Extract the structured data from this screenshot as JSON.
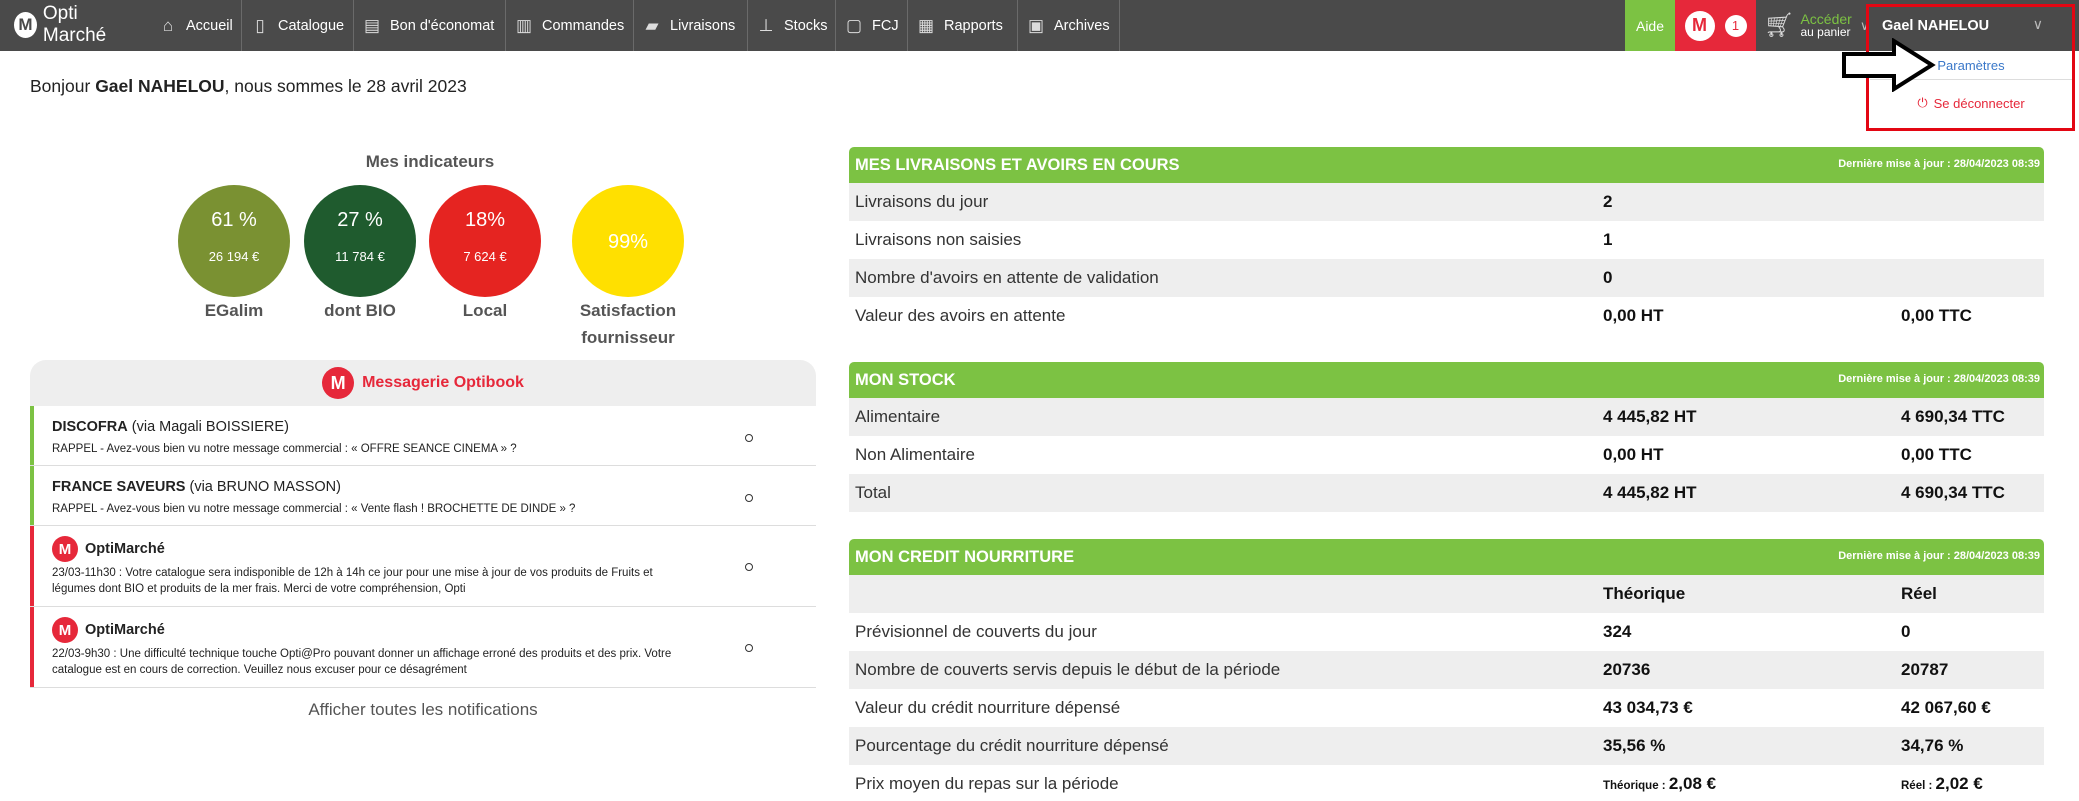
{
  "app": {
    "name": "Opti Marché"
  },
  "nav": {
    "items": [
      {
        "label": "Accueil",
        "icon": "home-icon"
      },
      {
        "label": "Catalogue",
        "icon": "book-icon"
      },
      {
        "label": "Bon d'économat",
        "icon": "form-icon"
      },
      {
        "label": "Commandes",
        "icon": "clipboard-icon"
      },
      {
        "label": "Livraisons",
        "icon": "truck-icon"
      },
      {
        "label": "Stocks",
        "icon": "forklift-icon"
      },
      {
        "label": "FCJ",
        "icon": "document-icon"
      },
      {
        "label": "Rapports",
        "icon": "chart-icon"
      },
      {
        "label": "Archives",
        "icon": "archive-icon"
      }
    ],
    "aide": "Aide",
    "messages_count": "1",
    "cart": {
      "line1": "Accéder",
      "line2": "au panier"
    },
    "user": "Gael NAHELOU"
  },
  "dropdown": {
    "settings": "Paramètres",
    "logout": "Se déconnecter"
  },
  "greeting": {
    "prefix": "Bonjour ",
    "name": "Gael NAHELOU",
    "suffix": ", nous sommes le 28 avril 2023"
  },
  "indicators": {
    "title": "Mes indicateurs",
    "items": [
      {
        "label": "EGalim",
        "pct": "61 %",
        "amount": "26 194 €",
        "color": "#7a9132",
        "value": 61
      },
      {
        "label": "dont BIO",
        "pct": "27 %",
        "amount": "11 784 €",
        "color": "#1f5b2e",
        "value": 27
      },
      {
        "label": "Local",
        "pct": "18%",
        "amount": "7 624 €",
        "color": "#e52421",
        "value": 18
      },
      {
        "label_line1": "Satisfaction",
        "label_line2": "fournisseur",
        "pct": "99%",
        "amount": "",
        "color": "#ffe000",
        "value": 99
      }
    ]
  },
  "messaging": {
    "title": "Messagerie Optibook",
    "all_label": "Afficher toutes les notifications",
    "messages": [
      {
        "sender": "DISCOFRA",
        "via": " (via Magali BOISSIERE)",
        "text": "RAPPEL - Avez-vous bien vu notre message commercial : « OFFRE SEANCE CINEMA » ?",
        "color": "#7cc243"
      },
      {
        "sender": "FRANCE SAVEURS",
        "via": " (via BRUNO MASSON)",
        "text": "RAPPEL - Avez-vous bien vu notre message commercial : « Vente flash ! BROCHETTE DE DINDE » ?",
        "color": "#7cc243"
      },
      {
        "sender": "OptiMarché",
        "via": "",
        "text_l1": "23/03-11h30 : Votre catalogue sera indisponible de 12h à 14h ce jour pour une mise à jour de vos produits de Fruits et",
        "text_l2": "légumes dont BIO et produits de la mer frais. Merci de votre compréhension, Opti",
        "color": "#e6283a"
      },
      {
        "sender": "OptiMarché",
        "via": "",
        "text_l1": "22/03-9h30 : Une difficulté technique touche Opti@Pro pouvant donner un affichage erroné des produits et des prix. Votre",
        "text_l2": "catalogue est en cours de correction. Veuillez nous excuser pour ce désagrément",
        "color": "#e6283a"
      }
    ]
  },
  "deliveries": {
    "title": "MES LIVRAISONS ET AVOIRS EN COURS",
    "updated": "Dernière mise à jour : 28/04/2023 08:39",
    "rows": [
      {
        "label": "Livraisons du jour",
        "v1": "2",
        "v2": ""
      },
      {
        "label": "Livraisons non saisies",
        "v1": "1",
        "v2": ""
      },
      {
        "label": "Nombre d'avoirs en attente de validation",
        "v1": "0",
        "v2": ""
      },
      {
        "label": "Valeur des avoirs en attente",
        "v1": "0,00 HT",
        "v2": "0,00 TTC"
      }
    ]
  },
  "stock": {
    "title": "MON STOCK",
    "updated": "Dernière mise à jour : 28/04/2023 08:39",
    "rows": [
      {
        "label": "Alimentaire",
        "v1": "4 445,82 HT",
        "v2": "4 690,34 TTC"
      },
      {
        "label": "Non Alimentaire",
        "v1": "0,00 HT",
        "v2": "0,00 TTC"
      },
      {
        "label": "Total",
        "v1": "4 445,82 HT",
        "v2": "4 690,34 TTC"
      }
    ]
  },
  "credit": {
    "title": "MON CREDIT NOURRITURE",
    "updated": "Dernière mise à jour : 28/04/2023 08:39",
    "col1": "Théorique",
    "col2": "Réel",
    "rows": [
      {
        "label": "Prévisionnel de couverts du jour",
        "v1": "324",
        "v2": "0"
      },
      {
        "label": "Nombre de couverts servis depuis le début de la période",
        "v1": "20736",
        "v2": "20787"
      },
      {
        "label": "Valeur du crédit nourriture dépensé",
        "v1": "43 034,73 €",
        "v2": "42 067,60 €"
      },
      {
        "label": "Pourcentage du crédit nourriture dépensé",
        "v1": "35,56 %",
        "v2": "34,76 %"
      },
      {
        "label": "Prix moyen du repas sur la période",
        "p1": "Théorique : ",
        "v1": "2,08 €",
        "p2": "Réel : ",
        "v2": "2,02 €"
      }
    ]
  }
}
